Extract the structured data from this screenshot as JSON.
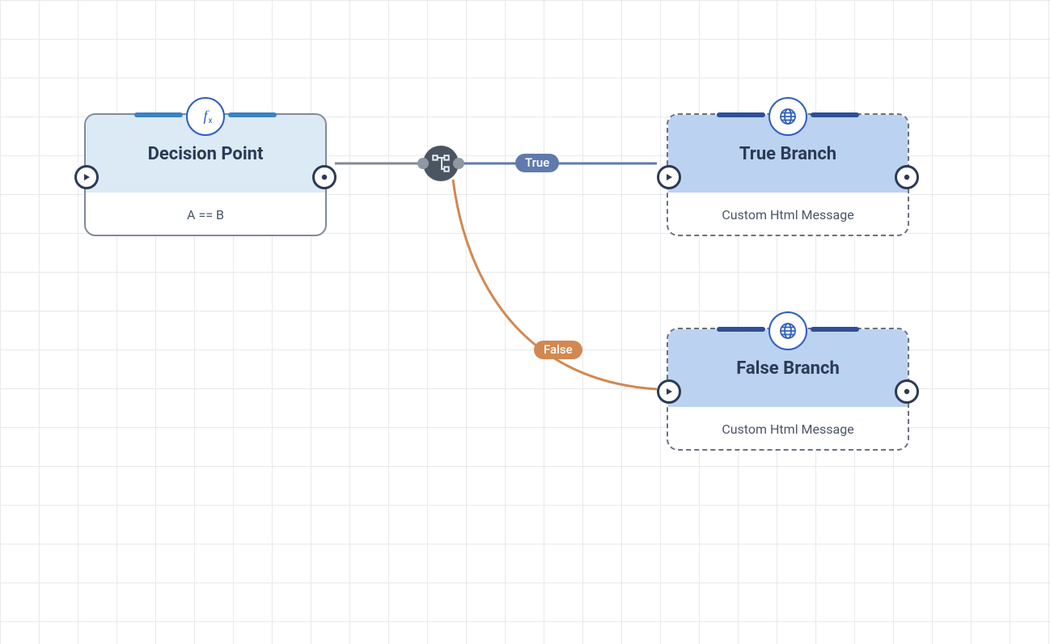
{
  "nodes": {
    "decision": {
      "title": "Decision Point",
      "expression": "A == B"
    },
    "true_branch": {
      "title": "True Branch",
      "subtitle": "Custom Html Message"
    },
    "false_branch": {
      "title": "False Branch",
      "subtitle": "Custom Html Message"
    }
  },
  "edges": {
    "true_label": "True",
    "false_label": "False"
  },
  "icons": {
    "decision": "fx-icon",
    "branch": "globe-icon",
    "junction": "branch-icon"
  },
  "colors": {
    "accent_blue": "#2f5fbf",
    "node_head_light": "#dceaf6",
    "node_head_blue": "#bcd2f1",
    "edge_gray": "#7f8a99",
    "edge_blue": "#5f7aad",
    "edge_orange": "#d28850"
  }
}
